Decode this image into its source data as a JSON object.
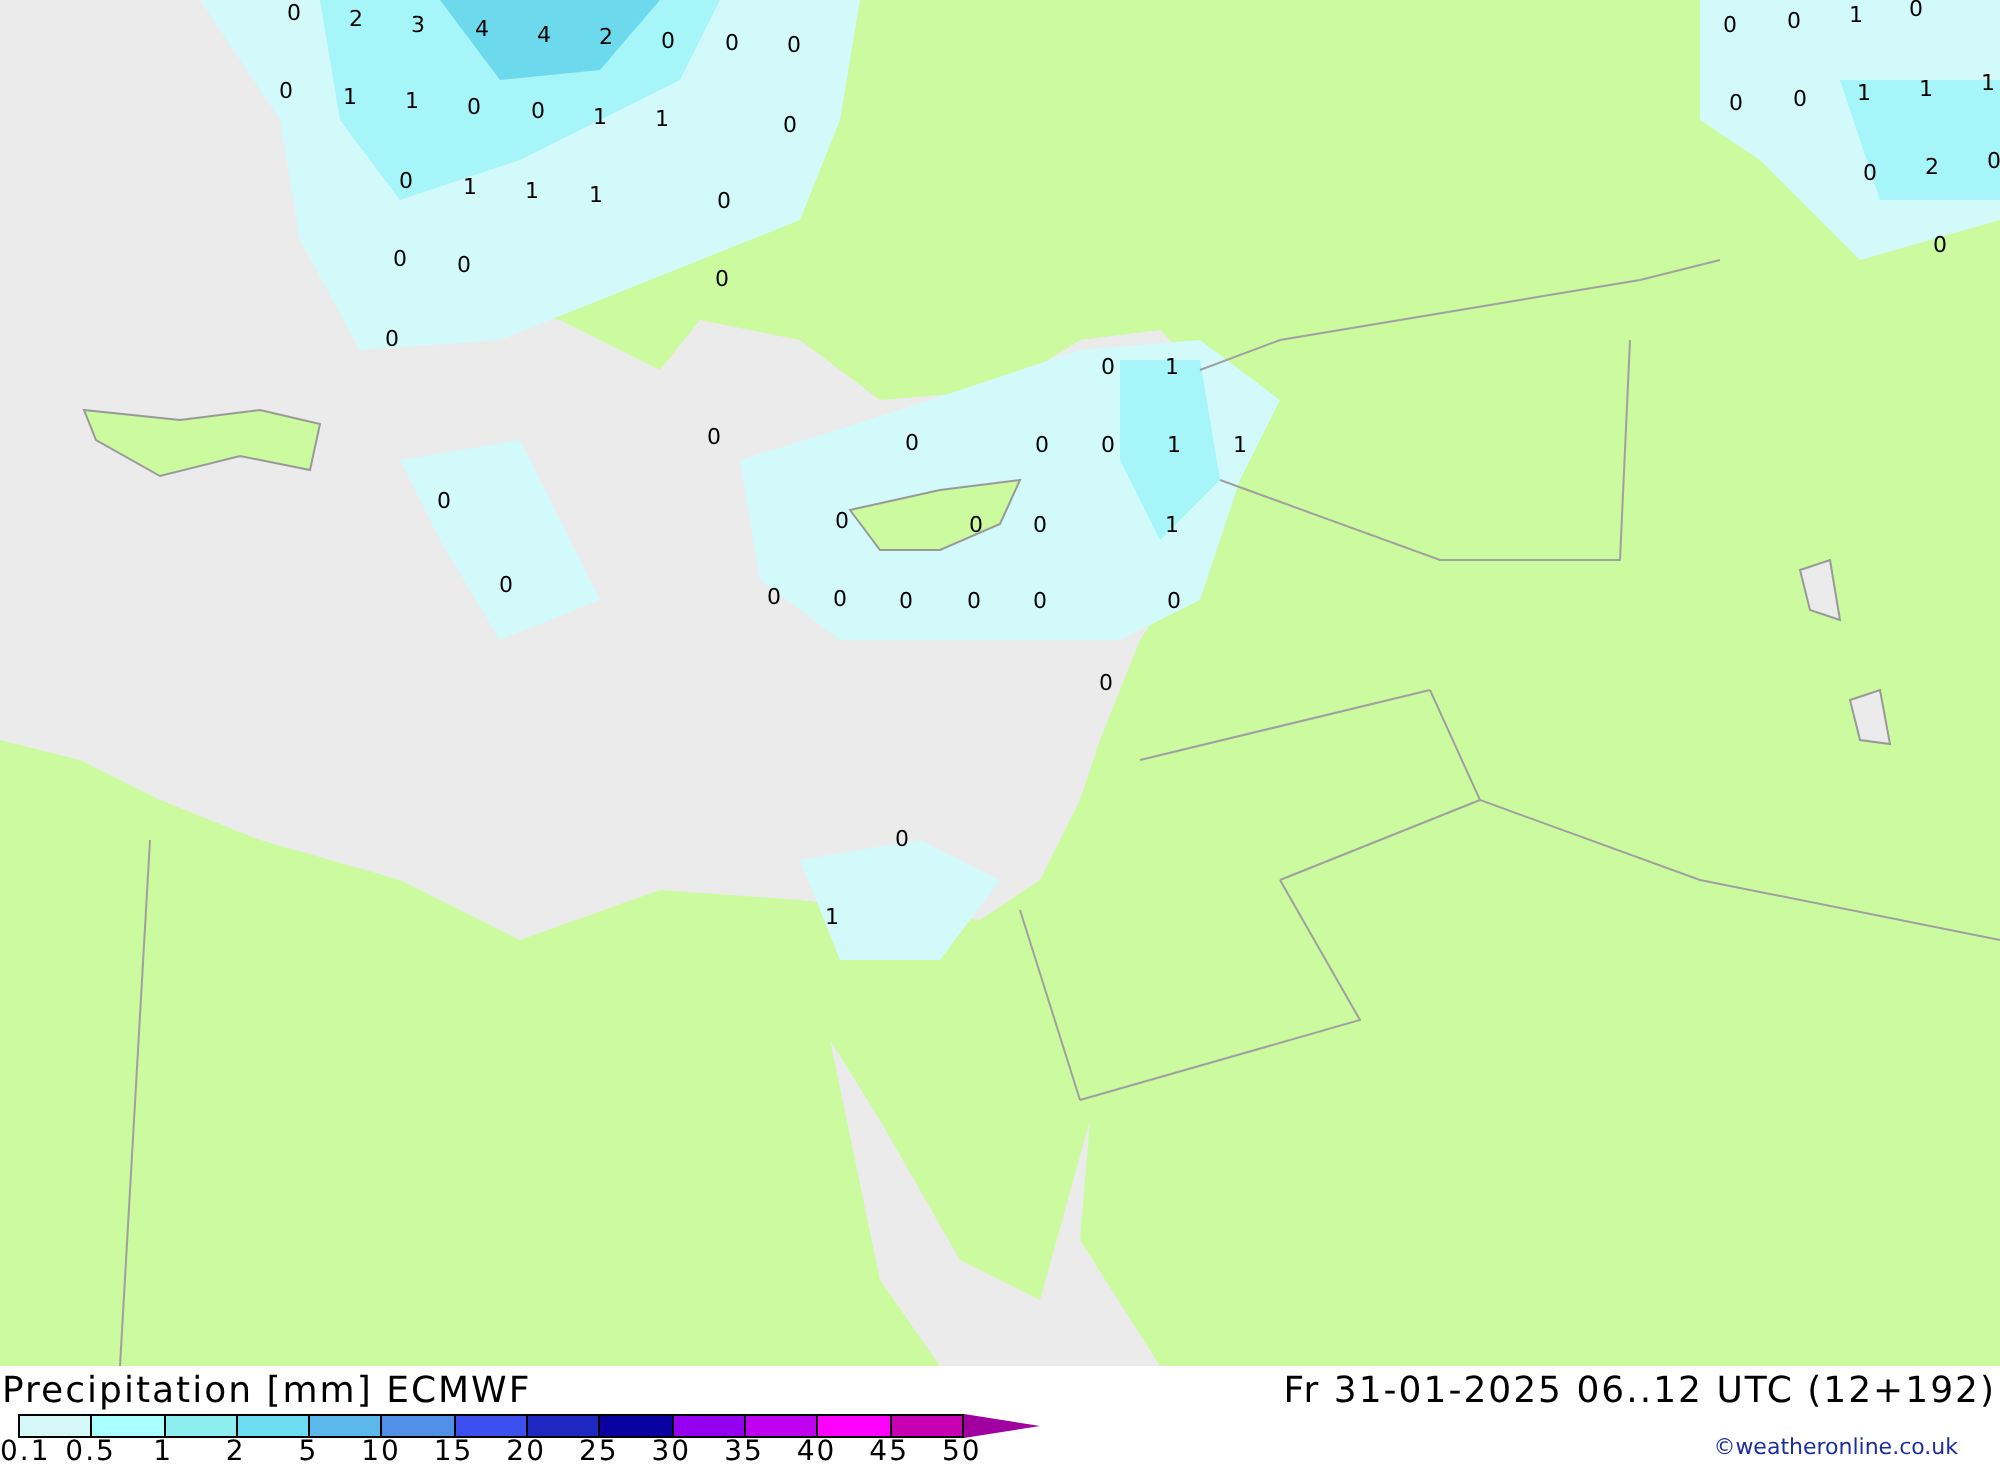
{
  "map": {
    "value_labels": [
      "0",
      "2",
      "3",
      "4",
      "4",
      "2",
      "0",
      "0",
      "0",
      "0",
      "1",
      "1",
      "0",
      "0",
      "1",
      "1",
      "0",
      "0",
      "1",
      "1",
      "1",
      "0",
      "0",
      "0",
      "0",
      "0",
      "0",
      "0",
      "1",
      "0",
      "0",
      "0",
      "1",
      "1",
      "1",
      "0",
      "2",
      "0",
      "0",
      "0",
      "1",
      "0",
      "0",
      "0",
      "0",
      "1",
      "1",
      "0",
      "0",
      "0",
      "0",
      "1",
      "0",
      "0",
      "0",
      "0",
      "0",
      "0",
      "0",
      "0",
      "0",
      "1"
    ]
  },
  "footer": {
    "title": "Precipitation [mm] ECMWF",
    "valid_time": "Fr 31-01-2025 06..12 UTC (12+192)",
    "credit": "©weatheronline.co.uk"
  },
  "legend": {
    "swatches": [
      {
        "color": "#d4f8f8"
      },
      {
        "color": "#aaffff"
      },
      {
        "color": "#8ceeee"
      },
      {
        "color": "#6cdcf0"
      },
      {
        "color": "#5cb8ea"
      },
      {
        "color": "#5090e8"
      },
      {
        "color": "#3c50f0"
      },
      {
        "color": "#1e28c0"
      },
      {
        "color": "#0a00a0"
      },
      {
        "color": "#9600f0"
      },
      {
        "color": "#c000f0"
      },
      {
        "color": "#ff00ff"
      },
      {
        "color": "#c800b4"
      }
    ],
    "ticks": [
      "0.1",
      "0.5",
      "1",
      "2",
      "5",
      "10",
      "15",
      "20",
      "25",
      "30",
      "35",
      "40",
      "45",
      "50"
    ]
  }
}
